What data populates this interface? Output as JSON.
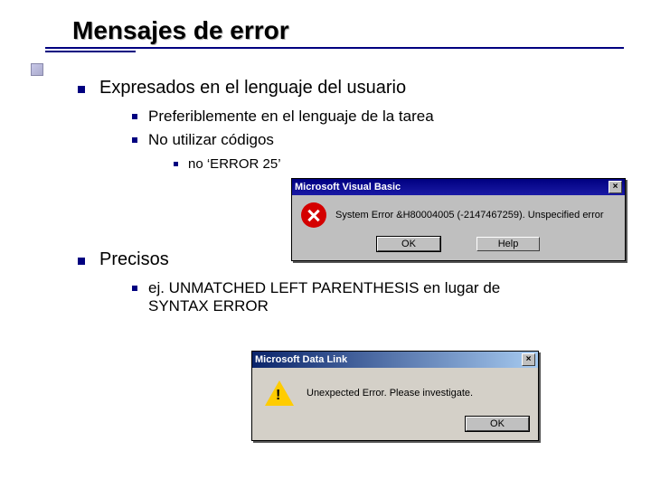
{
  "title": "Mensajes de error",
  "bullets": {
    "b1": {
      "text": "Expresados en el lenguaje del usuario",
      "sub": {
        "s1": "Preferiblemente en el lenguaje de la tarea",
        "s2": "No utilizar códigos",
        "s2_sub": "no ‘ERROR 25’"
      }
    },
    "b2": {
      "text": "Precisos",
      "sub": {
        "s1": "ej. UNMATCHED LEFT PARENTHESIS en lugar de SYNTAX ERROR"
      }
    }
  },
  "dialog1": {
    "title": "Microsoft Visual Basic",
    "message": "System Error &H80004005 (-2147467259).  Unspecified error",
    "ok": "OK",
    "help": "Help",
    "close": "×"
  },
  "dialog2": {
    "title": "Microsoft Data Link",
    "message": "Unexpected Error. Please investigate.",
    "ok": "OK",
    "close": "×"
  }
}
